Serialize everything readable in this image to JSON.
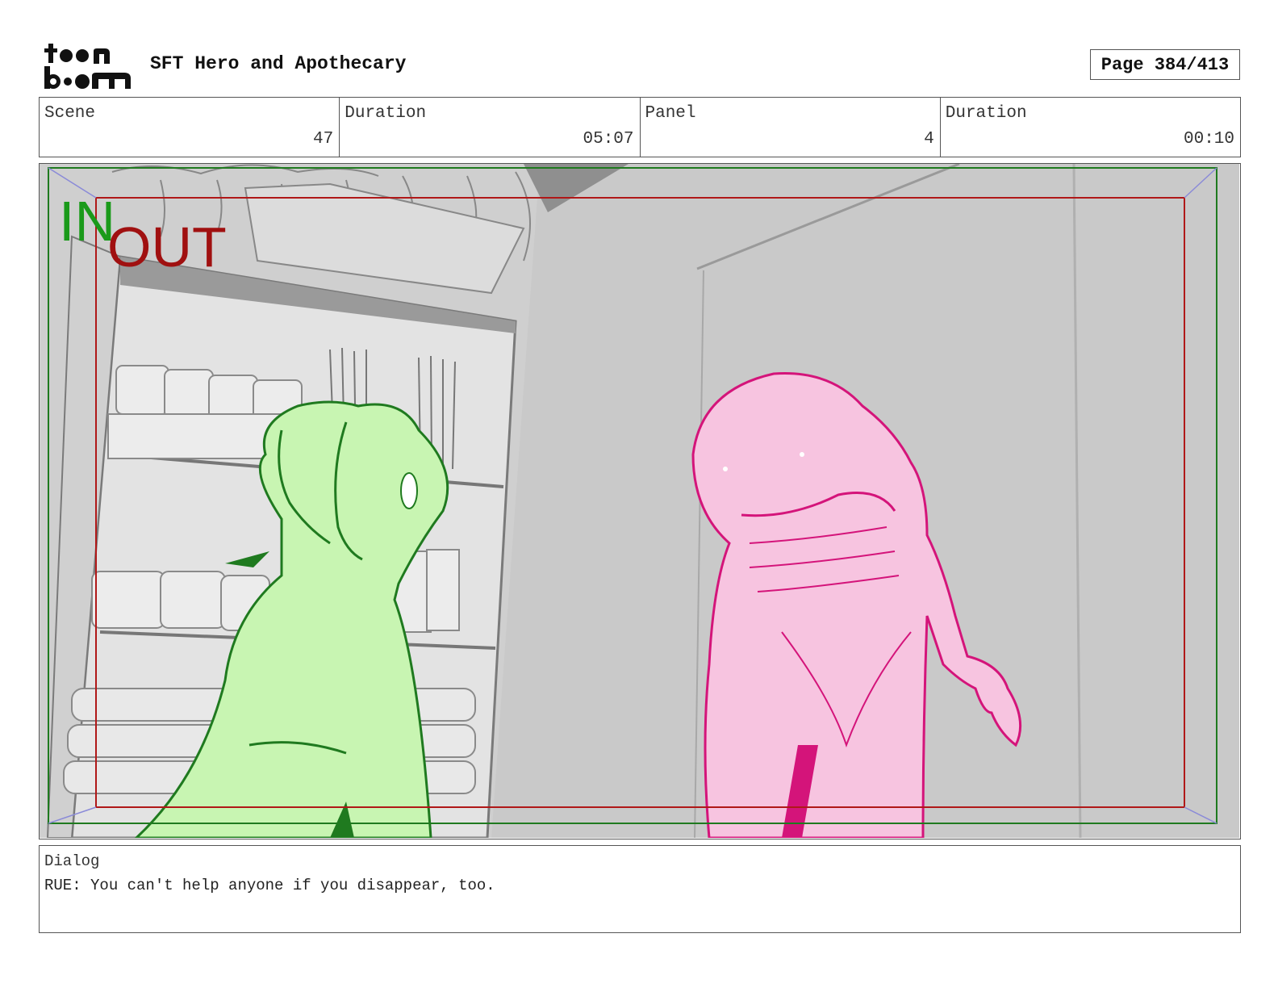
{
  "header": {
    "brand": "toon boom",
    "title": "SFT Hero and Apothecary",
    "page": "Page 384/413"
  },
  "info": {
    "scene_label": "Scene",
    "scene_value": "47",
    "scene_duration_label": "Duration",
    "scene_duration_value": "05:07",
    "panel_label": "Panel",
    "panel_value": "4",
    "panel_duration_label": "Duration",
    "panel_duration_value": "00:10"
  },
  "panel": {
    "in_label": "IN",
    "out_label": "OUT",
    "in_color": "#1a9a1a",
    "out_color": "#a01010",
    "left_character_color": "#c8f5b2",
    "right_character_color": "#f7c4e0"
  },
  "dialog": {
    "label": "Dialog",
    "text": "RUE: You can't help anyone if you disappear, too."
  }
}
